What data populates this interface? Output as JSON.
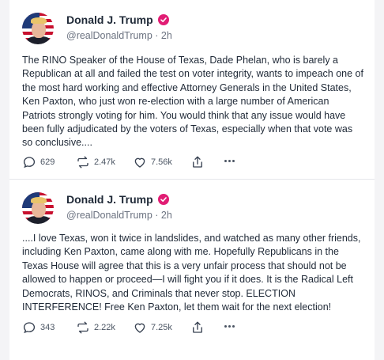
{
  "colors": {
    "accent": "#e11d74",
    "text": "#1f2937",
    "muted": "#6b7280",
    "background": "#f4f4f6"
  },
  "posts": [
    {
      "author": {
        "name": "Donald J. Trump",
        "handle": "@realDonaldTrump",
        "time": "2h",
        "verified_icon": "verified-check-icon"
      },
      "text": "The RINO Speaker of the House of Texas, Dade Phelan, who is barely a Republican at all and failed the test on voter integrity, wants to impeach one of the most hard working and effective Attorney Generals in the United States, Ken Paxton, who just won re-election with a large number of American Patriots strongly voting for him. You would think that any issue would have been fully adjudicated by the voters of Texas, especially when that vote was so conclusive....",
      "stats": {
        "replies": "629",
        "retruths": "2.47k",
        "likes": "7.56k"
      }
    },
    {
      "author": {
        "name": "Donald J. Trump",
        "handle": "@realDonaldTrump",
        "time": "2h",
        "verified_icon": "verified-check-icon"
      },
      "text": "....I love Texas, won it twice in landslides, and watched as many other friends, including Ken Paxton, came along with me. Hopefully Republicans in the Texas House will agree that this is a very unfair process that should not be allowed to happen or proceed—I will fight you if it does. It is the Radical Left Democrats, RINOS, and Criminals that never stop. ELECTION INTERFERENCE! Free Ken Paxton, let them wait for the next election!",
      "stats": {
        "replies": "343",
        "retruths": "2.22k",
        "likes": "7.25k"
      }
    }
  ],
  "separator": " · "
}
